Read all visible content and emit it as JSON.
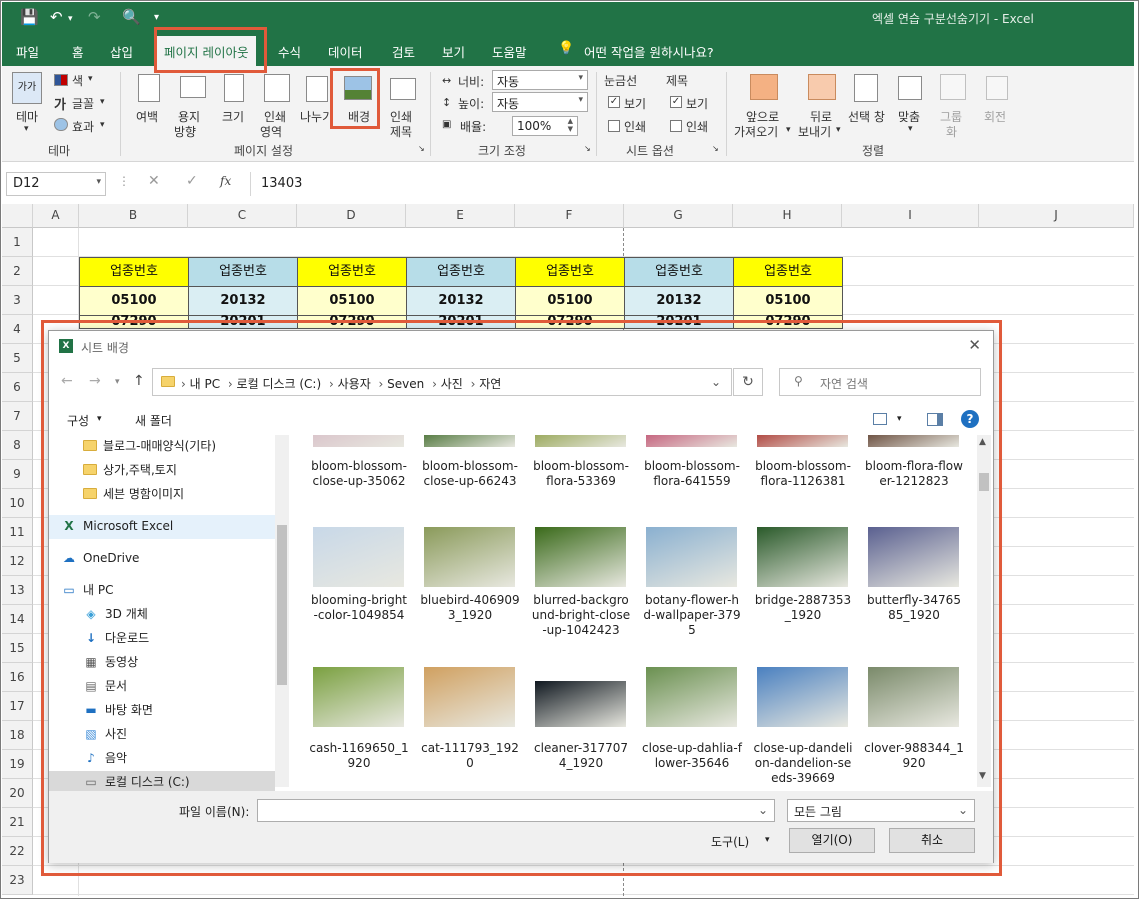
{
  "window": {
    "title": "엑셀 연습 구분선숨기기  -  Excel"
  },
  "tabs": [
    "파일",
    "홈",
    "삽입",
    "페이지 레이아웃",
    "수식",
    "데이터",
    "검토",
    "보기",
    "도움말"
  ],
  "active_tab": "페이지 레이아웃",
  "tell_me": "어떤 작업을 원하시나요?",
  "ribbon": {
    "theme": {
      "btn": "테마",
      "color": "색",
      "font": "글꼴",
      "effect": "효과",
      "group": "테마"
    },
    "page_setup": {
      "margins": "여백",
      "orientation": [
        "용지",
        "방향"
      ],
      "size": "크기",
      "print_area": [
        "인쇄",
        "영역"
      ],
      "breaks": "나누기",
      "background": "배경",
      "print_titles": [
        "인쇄",
        "제목"
      ],
      "group": "페이지 설정"
    },
    "scale": {
      "width_label": "너비:",
      "width_value": "자동",
      "height_label": "높이:",
      "height_value": "자동",
      "scale_label": "배율:",
      "scale_value": "100%",
      "group": "크기 조정"
    },
    "sheet_options": {
      "gridlines": "눈금선",
      "headings": "제목",
      "view": "보기",
      "print": "인쇄",
      "group": "시트 옵션"
    },
    "arrange": {
      "bring_forward": [
        "앞으로",
        "가져오기"
      ],
      "send_backward": [
        "뒤로",
        "보내기"
      ],
      "selection_pane": "선택 창",
      "align": "맞춤",
      "group_btn": [
        "그룹",
        "화"
      ],
      "rotate": "회전",
      "group": "정렬"
    }
  },
  "formula_bar": {
    "name_box": "D12",
    "fx": "fx",
    "value": "13403"
  },
  "columns": [
    "A",
    "B",
    "C",
    "D",
    "E",
    "F",
    "G",
    "H",
    "I",
    "J"
  ],
  "rows": [
    "1",
    "2",
    "3",
    "4",
    "5",
    "6",
    "7",
    "8",
    "9",
    "10",
    "11",
    "12",
    "13",
    "14",
    "15",
    "16",
    "17",
    "18",
    "19",
    "20",
    "21",
    "22",
    "23"
  ],
  "sheet_cells": {
    "headers": [
      "업종번호",
      "업종번호",
      "업종번호",
      "업종번호",
      "업종번호",
      "업종번호",
      "업종번호"
    ],
    "row3": [
      "05100",
      "20132",
      "05100",
      "20132",
      "05100",
      "20132",
      "05100"
    ],
    "row4": [
      "07290",
      "20201",
      "07290",
      "20201",
      "07290",
      "20201",
      "07290"
    ]
  },
  "dialog": {
    "title": "시트 배경",
    "path": [
      "내 PC",
      "로컬 디스크 (C:)",
      "사용자",
      "Seven",
      "사진",
      "자연"
    ],
    "search_placeholder": "자연 검색",
    "organize": "구성",
    "new_folder": "새 폴더",
    "nav_items": [
      {
        "label": "블로그-매매양식(기타)",
        "icon": "folder-icon"
      },
      {
        "label": "상가,주택,토지",
        "icon": "folder-icon"
      },
      {
        "label": "세븐 명함이미지",
        "icon": "folder-icon"
      },
      {
        "label": "Microsoft Excel",
        "icon": "excel-icon"
      },
      {
        "label": "OneDrive",
        "icon": "cloud-icon"
      },
      {
        "label": "내 PC",
        "icon": "pc-icon"
      },
      {
        "label": "3D 개체",
        "icon": "cube-icon"
      },
      {
        "label": "다운로드",
        "icon": "download-icon"
      },
      {
        "label": "동영상",
        "icon": "video-icon"
      },
      {
        "label": "문서",
        "icon": "document-icon"
      },
      {
        "label": "바탕 화면",
        "icon": "desktop-icon"
      },
      {
        "label": "사진",
        "icon": "picture-icon"
      },
      {
        "label": "음악",
        "icon": "music-icon"
      },
      {
        "label": "로컬 디스크 (C:)",
        "icon": "drive-icon"
      }
    ],
    "files_top": [
      "bloom-blossom-close-up-35062",
      "bloom-blossom-close-up-66243",
      "bloom-blossom-flora-53369",
      "bloom-blossom-flora-641559",
      "bloom-blossom-flora-1126381",
      "bloom-flora-flower-1212823"
    ],
    "files_mid": [
      "blooming-bright-color-1049854",
      "bluebird-4069093_1920",
      "blurred-background-bright-close-up-1042423",
      "botany-flower-hd-wallpaper-3795",
      "bridge-2887353_1920",
      "butterfly-3476585_1920"
    ],
    "files_bot": [
      "cash-1169650_1920",
      "cat-111793_1920",
      "cleaner-3177074_1920",
      "close-up-dahlia-flower-35646",
      "close-up-dandelion-dandelion-seeds-39669",
      "clover-988344_1920"
    ],
    "filename_label": "파일 이름(N):",
    "filename_value": "",
    "filter": "모든 그림",
    "tools": "도구(L)",
    "open": "열기(O)",
    "cancel": "취소"
  },
  "colors": {
    "excel_green": "#217346",
    "highlight": "#e05a3a",
    "yellow_cell": "#ffff00",
    "blue_cell": "#b7dde8"
  }
}
